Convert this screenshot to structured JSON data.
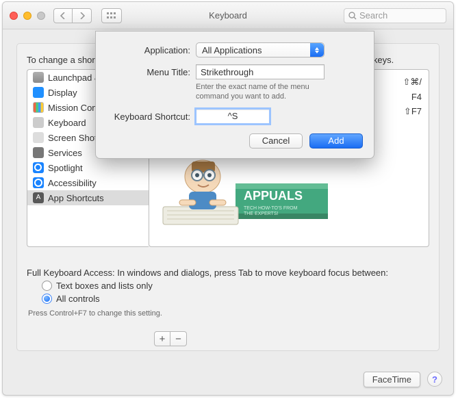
{
  "window": {
    "title": "Keyboard",
    "search_placeholder": "Search"
  },
  "page": {
    "intro": "To change a shortcut, select it, double-click the key combination, and then type the new keys."
  },
  "sidebar": {
    "items": [
      {
        "label": "Launchpad & Dock"
      },
      {
        "label": "Display"
      },
      {
        "label": "Mission Control"
      },
      {
        "label": "Keyboard"
      },
      {
        "label": "Screen Shots"
      },
      {
        "label": "Services"
      },
      {
        "label": "Spotlight"
      },
      {
        "label": "Accessibility"
      },
      {
        "label": "App Shortcuts"
      }
    ],
    "selected_index": 8
  },
  "shortcuts": {
    "visible": [
      "⇧⌘/",
      "F4",
      "⇧F7"
    ]
  },
  "buttons": {
    "plus": "+",
    "minus": "−"
  },
  "access": {
    "heading": "Full Keyboard Access: In windows and dialogs, press Tab to move keyboard focus between:",
    "option_text": "Text boxes and lists only",
    "option_all": "All controls",
    "selected": "all",
    "hint": "Press Control+F7 to change this setting."
  },
  "sheet": {
    "labels": {
      "application": "Application:",
      "menu_title": "Menu Title:",
      "shortcut": "Keyboard Shortcut:"
    },
    "application_value": "All Applications",
    "menu_title_value": "Strikethrough",
    "menu_title_hint": "Enter the exact name of the menu command you want to add.",
    "shortcut_value": "^S",
    "cancel": "Cancel",
    "add": "Add"
  },
  "bottom": {
    "facetime_chip": "FaceTime",
    "help": "?"
  },
  "watermark": {
    "brand": "APPUALS",
    "tagline1": "TECH HOW-TO'S FROM",
    "tagline2": "THE EXPERTS!"
  },
  "colors": {
    "accent": "#1a6df3",
    "selection": "#dcdcdc"
  }
}
